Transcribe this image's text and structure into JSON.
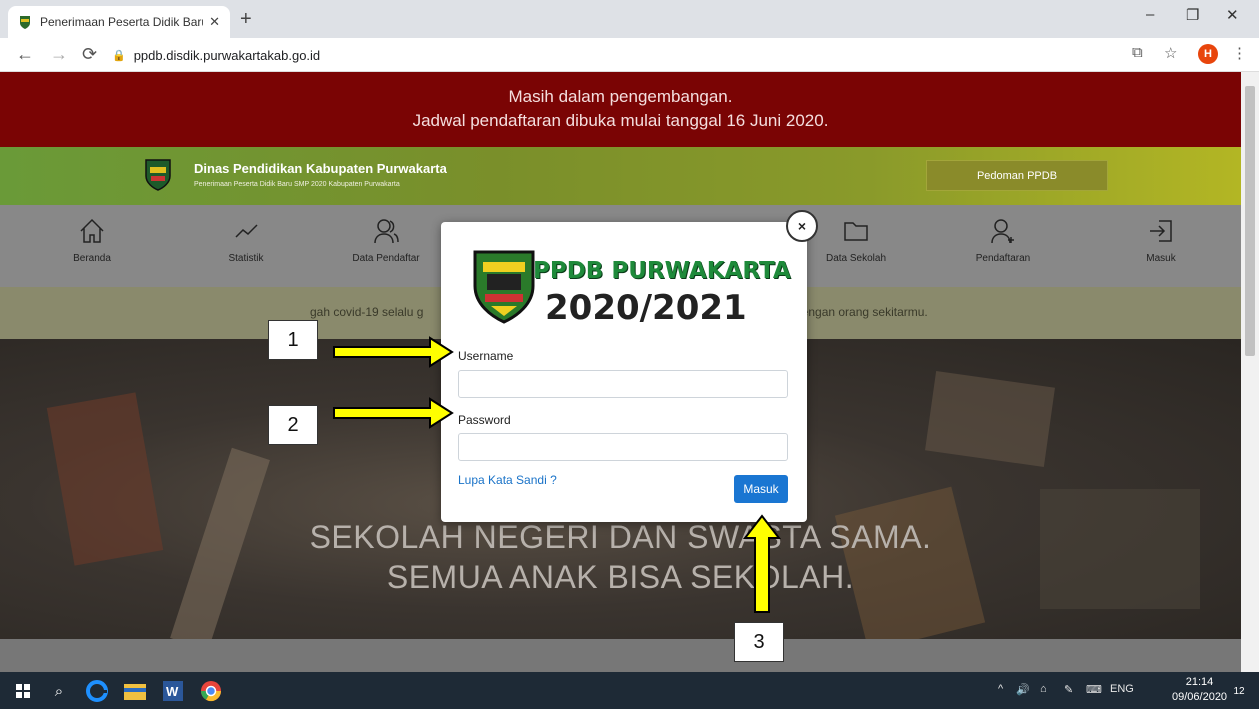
{
  "browser": {
    "tab_title": "Penerimaan Peserta Didik Baru SM",
    "tab_close": "✕",
    "new_tab": "+",
    "url": "ppdb.disdik.purwakartakab.go.id",
    "profile_initial": "H",
    "win_min": "–",
    "win_restore": "❐",
    "win_close": "✕"
  },
  "banner": {
    "line1": "Masih dalam pengembangan.",
    "line2": "Jadwal pendaftaran dibuka mulai tanggal 16 Juni 2020."
  },
  "brand": {
    "name": "Dinas Pendidikan Kabupaten Purwakarta",
    "subtitle": "Penerimaan Peserta Didik Baru SMP 2020 Kabupaten Purwakarta",
    "pedoman_label": "Pedoman PPDB"
  },
  "menu": {
    "beranda": "Beranda",
    "statistik": "Statistik",
    "data_pendaftar": "Data Pendaftar",
    "data_sekolah": "Data Sekolah",
    "pendaftaran": "Pendaftaran",
    "masuk": "Masuk"
  },
  "notice": {
    "left": "gah covid-19 selalu g",
    "right": "dengan orang sekitarmu."
  },
  "hero": {
    "line1": "SEKOLAH NEGERI DAN SWASTA SAMA.",
    "line2": "SEMUA ANAK BISA SEKOLAH."
  },
  "modal": {
    "close": "×",
    "ppdb_title": "PPDB PURWAKARTA",
    "year": "2020/2021",
    "username_label": "Username",
    "username_value": "",
    "password_label": "Password",
    "password_value": "",
    "forgot_label": "Lupa Kata Sandi ?",
    "submit_label": "Masuk"
  },
  "annotations": {
    "n1": "1",
    "n2": "2",
    "n3": "3"
  },
  "taskbar": {
    "lang": "ENG",
    "time": "21:14",
    "date": "09/06/2020",
    "notif_count": "12"
  },
  "colors": {
    "banner": "#7a0404",
    "accent": "#1a76d2",
    "arrow": "#ffff00"
  }
}
